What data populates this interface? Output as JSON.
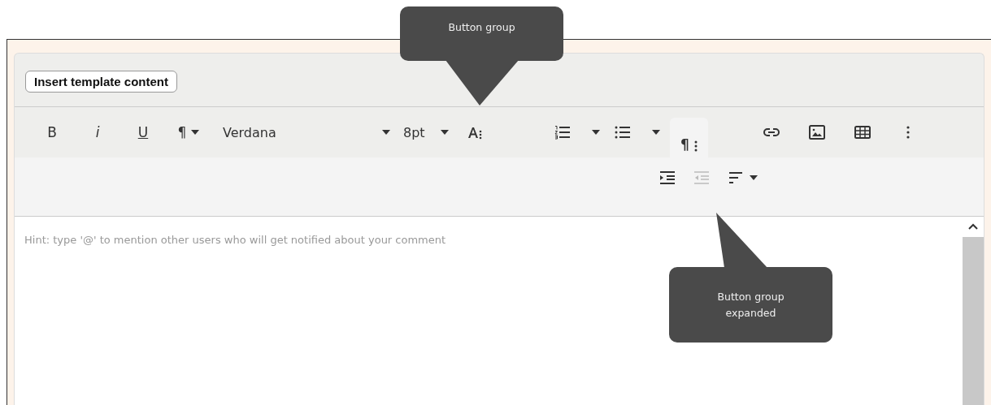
{
  "header": {
    "insert_button": "Insert template content"
  },
  "toolbar_row_1": [
    {
      "kind": "bold",
      "label": "B"
    },
    {
      "kind": "italic",
      "label": "i"
    },
    {
      "kind": "underline",
      "label": "U"
    },
    {
      "kind": "paragraph",
      "label": "¶"
    },
    {
      "kind": "font",
      "label": "Verdana"
    },
    {
      "kind": "size",
      "label": "8pt"
    },
    {
      "kind": "font-more"
    },
    {
      "kind": "ordered-list"
    },
    {
      "kind": "bullet-list"
    },
    {
      "kind": "more-group",
      "label": "¶",
      "expanded": true
    },
    {
      "kind": "link"
    },
    {
      "kind": "image"
    },
    {
      "kind": "table"
    },
    {
      "kind": "overflow"
    }
  ],
  "toolbar_row_2": [
    {
      "kind": "indent",
      "disabled": false
    },
    {
      "kind": "outdent",
      "disabled": true
    },
    {
      "kind": "align"
    }
  ],
  "editor": {
    "placeholder": "Hint: type '@' to mention other users who will get notified about your comment"
  },
  "callouts": [
    {
      "kind": "down",
      "text": "Button group"
    },
    {
      "kind": "up",
      "text": "Button group expanded"
    }
  ]
}
